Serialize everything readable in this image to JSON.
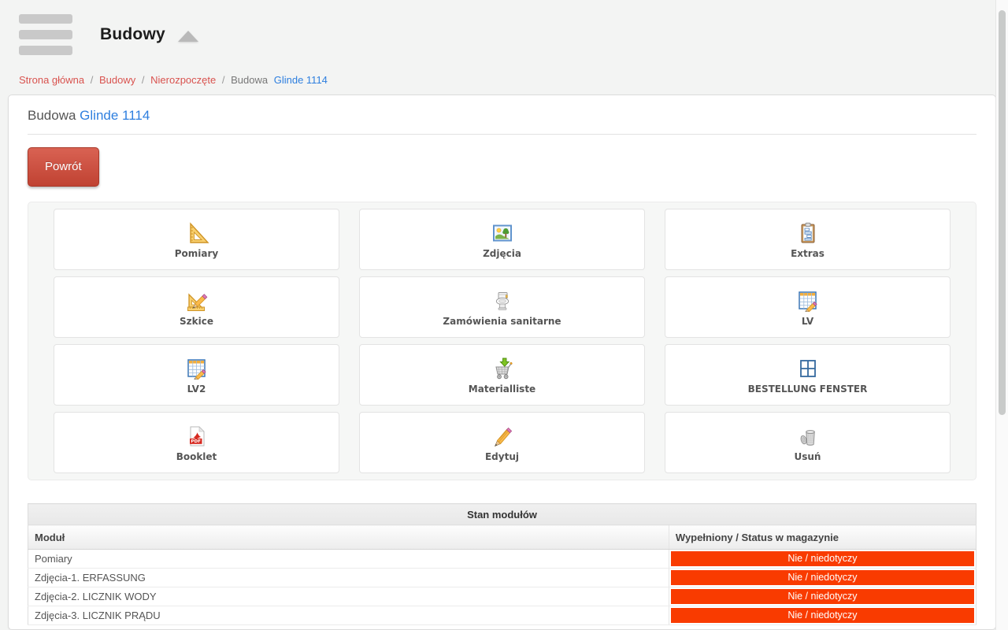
{
  "header": {
    "title": "Budowy"
  },
  "breadcrumb": {
    "separator": "/",
    "home": "Strona główna",
    "budowy": "Budowy",
    "nierozpoczete": "Nierozpoczęte",
    "budowa": "Budowa",
    "current": "Glinde 1114"
  },
  "page": {
    "title_prefix": "Budowa",
    "title_link": "Glinde 1114"
  },
  "toolbar": {
    "back_label": "Powrót"
  },
  "tiles": [
    {
      "label": "Pomiary",
      "icon": "set-square-icon"
    },
    {
      "label": "Zdjęcia",
      "icon": "photo-icon"
    },
    {
      "label": "Extras",
      "icon": "clipboard-icon"
    },
    {
      "label": "Szkice",
      "icon": "sketch-icon"
    },
    {
      "label": "Zamówienia sanitarne",
      "icon": "toilet-icon"
    },
    {
      "label": "LV",
      "icon": "spreadsheet-pencil-icon"
    },
    {
      "label": "LV2",
      "icon": "spreadsheet-pencil-icon"
    },
    {
      "label": "Materialliste",
      "icon": "cart-download-icon"
    },
    {
      "label": "BESTELLUNG FENSTER",
      "icon": "window-icon"
    },
    {
      "label": "Booklet",
      "icon": "pdf-icon",
      "icon_text": "PDF"
    },
    {
      "label": "Edytuj",
      "icon": "pencil-icon"
    },
    {
      "label": "Usuń",
      "icon": "trash-icon"
    }
  ],
  "module_table": {
    "caption": "Stan modułów",
    "columns": {
      "module": "Moduł",
      "status": "Wypełniony / Status w magazynie"
    },
    "rows": [
      {
        "module": "Pomiary",
        "status": "Nie / niedotyczy"
      },
      {
        "module": "Zdjęcia-1. ERFASSUNG",
        "status": "Nie / niedotyczy"
      },
      {
        "module": "Zdjęcia-2. LICZNIK WODY",
        "status": "Nie / niedotyczy"
      },
      {
        "module": "Zdjęcia-3. LICZNIK PRĄDU",
        "status": "Nie / niedotyczy"
      }
    ]
  },
  "colors": {
    "badge": "#f93b00",
    "button_top": "#d96253",
    "button_bottom": "#c04232",
    "button_border": "#a8392a",
    "link_red": "#d9534f",
    "link_blue": "#2e7fdf"
  }
}
